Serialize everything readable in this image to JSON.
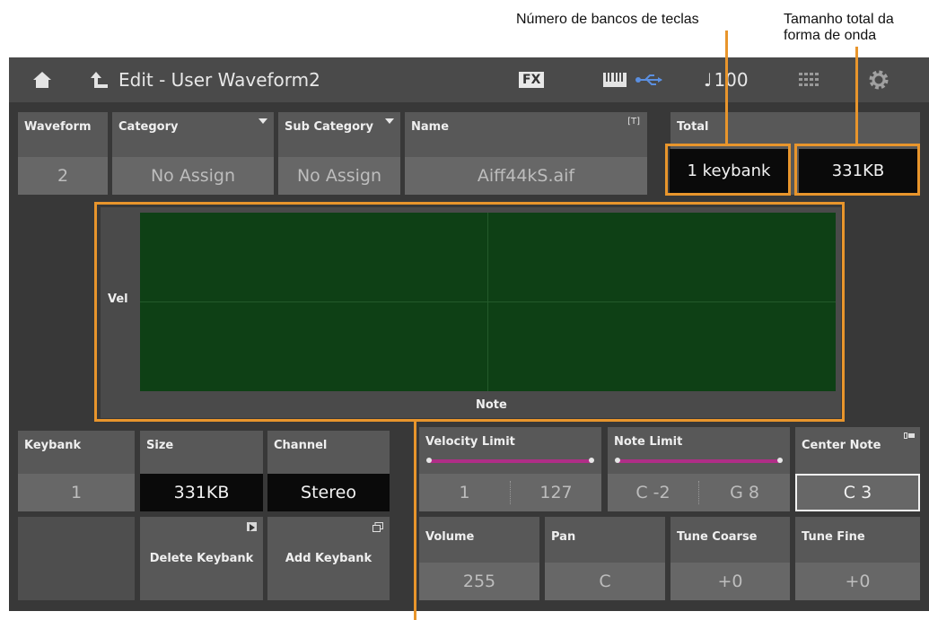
{
  "annotations": {
    "keybanks": "Número de bancos de teclas",
    "total_size_line1": "Tamanho total da",
    "total_size_line2": "forma de onda"
  },
  "titlebar": {
    "title": "Edit - User Waveform2",
    "fx_label": "FX",
    "tempo": "100"
  },
  "fields": {
    "waveform": {
      "label": "Waveform",
      "value": "2"
    },
    "category": {
      "label": "Category",
      "value": "No Assign"
    },
    "sub_category": {
      "label": "Sub Category",
      "value": "No Assign"
    },
    "name": {
      "label": "Name",
      "tag": "[T]",
      "value": "Aiff44kS.aif"
    },
    "total": {
      "label": "Total",
      "keybank_value": "1 keybank",
      "size_value": "331KB"
    }
  },
  "map": {
    "y_label": "Vel",
    "x_label": "Note"
  },
  "keybank_fields": {
    "keybank": {
      "label": "Keybank",
      "value": "1"
    },
    "size": {
      "label": "Size",
      "value": "331KB"
    },
    "channel": {
      "label": "Channel",
      "value": "Stereo"
    },
    "delete_label": "Delete Keybank",
    "add_label": "Add Keybank"
  },
  "limits": {
    "velocity": {
      "label": "Velocity Limit",
      "low": "1",
      "high": "127"
    },
    "note": {
      "label": "Note Limit",
      "low": "C -2",
      "high": "G 8"
    },
    "center_note": {
      "label": "Center Note",
      "value": "C 3"
    }
  },
  "params": {
    "volume": {
      "label": "Volume",
      "value": "255"
    },
    "pan": {
      "label": "Pan",
      "value": "C"
    },
    "tune_coarse": {
      "label": "Tune Coarse",
      "value": "+0"
    },
    "tune_fine": {
      "label": "Tune Fine",
      "value": "+0"
    }
  },
  "colors": {
    "accent": "#e8952c",
    "map_fill": "#0e4015",
    "slider": "#b02e87"
  },
  "icons": [
    "home-icon",
    "back-icon",
    "keyboard-icon",
    "usb-icon",
    "note-icon",
    "grid-icon",
    "gear-icon",
    "play-icon",
    "window-icon",
    "battery-icon"
  ]
}
